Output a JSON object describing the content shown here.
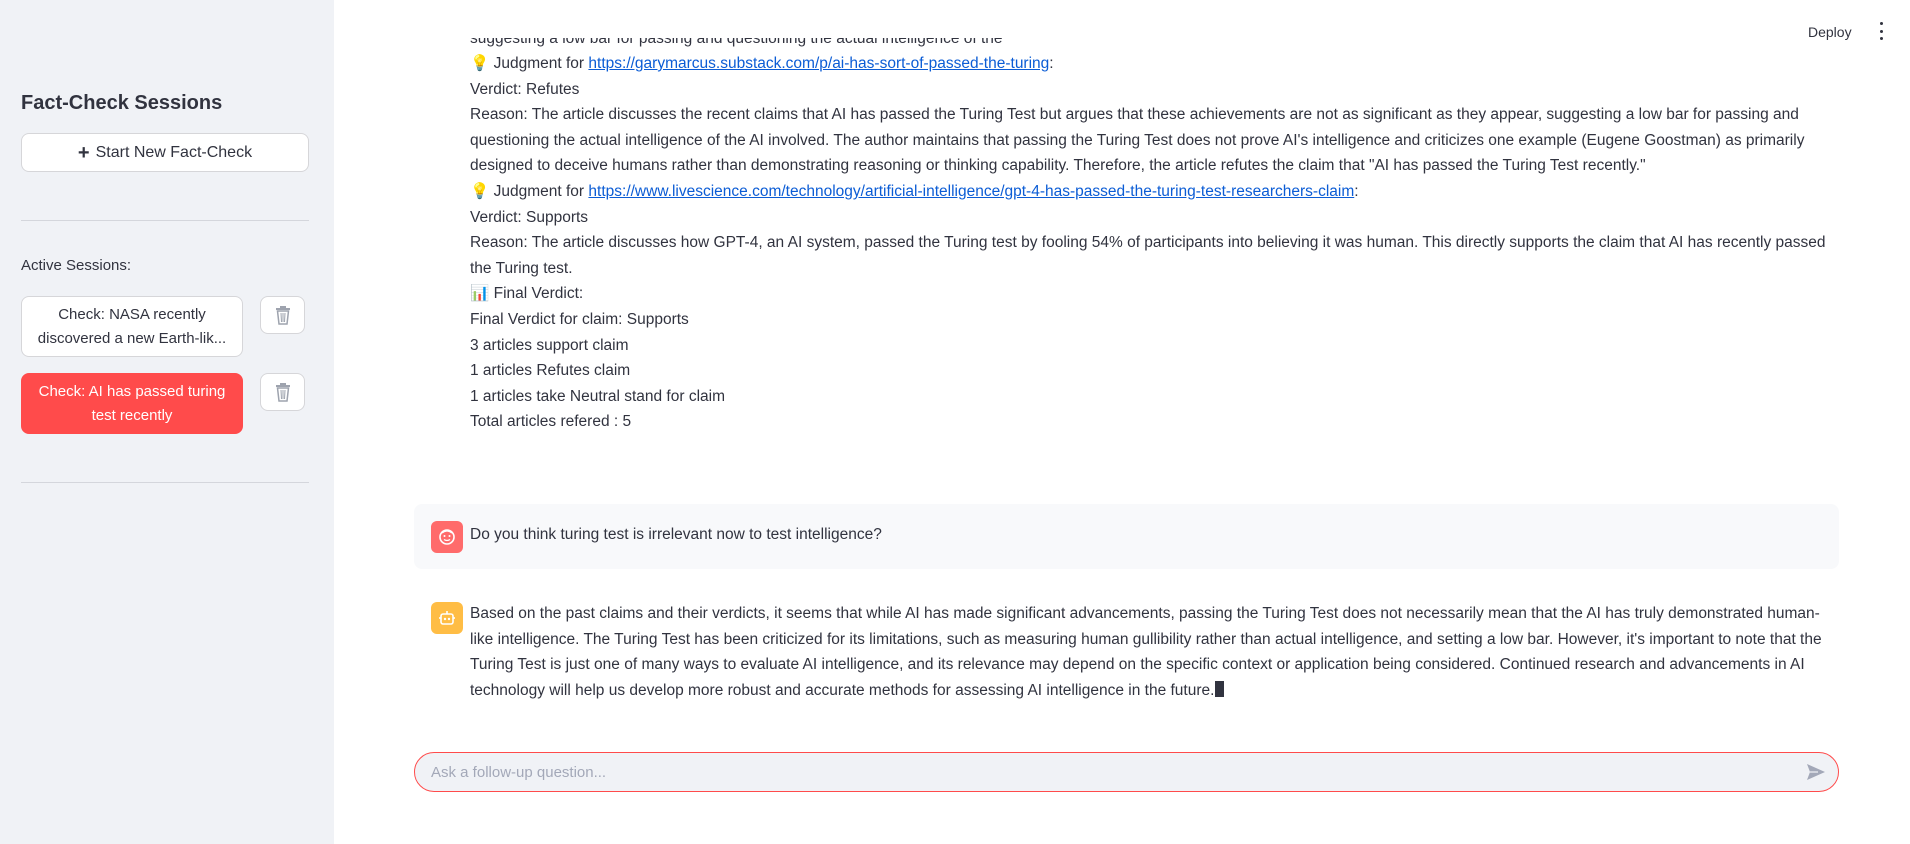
{
  "sidebar": {
    "title": "Fact-Check Sessions",
    "new_button": "Start New Fact-Check",
    "active_label": "Active Sessions:",
    "sessions": [
      {
        "label": "Check: NASA recently discovered a new Earth-lik..."
      },
      {
        "label": "Check: AI has passed turing test recently"
      }
    ]
  },
  "header": {
    "deploy_label": "Deploy"
  },
  "transcript": {
    "clipped_top": "suggesting a low bar for passing and questioning the actual intelligence of the",
    "judgment_prefix": "Judgment for",
    "judgment1_url": "https://garymarcus.substack.com/p/ai-has-sort-of-passed-the-turing",
    "verdict1": "Verdict: Refutes",
    "reason1": "Reason: The article discusses the recent claims that AI has passed the Turing Test but argues that these achievements are not as significant as they appear, suggesting a low bar for passing and questioning the actual intelligence of the AI involved. The author maintains that passing the Turing Test does not prove AI's intelligence and criticizes one example (Eugene Goostman) as primarily designed to deceive humans rather than demonstrating reasoning or thinking capability. Therefore, the article refutes the claim that \"AI has passed the Turing Test recently.\"",
    "judgment2_url": "https://www.livescience.com/technology/artificial-intelligence/gpt-4-has-passed-the-turing-test-researchers-claim",
    "verdict2": "Verdict: Supports",
    "reason2": "Reason: The article discusses how GPT-4, an AI system, passed the Turing test by fooling 54% of participants into believing it was human. This directly supports the claim that AI has recently passed the Turing test.",
    "final_heading": "Final Verdict:",
    "final_claim": "Final Verdict for claim: Supports",
    "support_count": "3 articles support claim",
    "refute_count": "1 articles Refutes claim",
    "neutral_count": "1 articles take Neutral stand for claim",
    "total": "Total articles refered : 5"
  },
  "user_message": "Do you think turing test is irrelevant now to test intelligence?",
  "assistant_message": "Based on the past claims and their verdicts, it seems that while AI has made significant advancements, passing the Turing Test does not necessarily mean that the AI has truly demonstrated human-like intelligence. The Turing Test has been criticized for its limitations, such as measuring human gullibility rather than actual intelligence, and setting a low bar. However, it's important to note that the Turing Test is just one of many ways to evaluate AI intelligence, and its relevance may depend on the specific context or application being considered. Continued research and advancements in AI technology will help us develop more robust and accurate methods for assessing AI intelligence in the future.",
  "chat_input": {
    "placeholder": "Ask a follow-up question...",
    "value": ""
  },
  "colors": {
    "accent": "#ff4b4b",
    "sidebar_bg": "#f0f2f6",
    "link": "#0b5cd5",
    "bot_avatar": "#ffbd45",
    "user_avatar": "#ff6b6b"
  },
  "icons": [
    "plus-icon",
    "trash-icon",
    "kebab-menu-icon",
    "lightbulb-icon",
    "bar-chart-icon",
    "user-avatar-icon",
    "bot-avatar-icon",
    "send-icon"
  ]
}
